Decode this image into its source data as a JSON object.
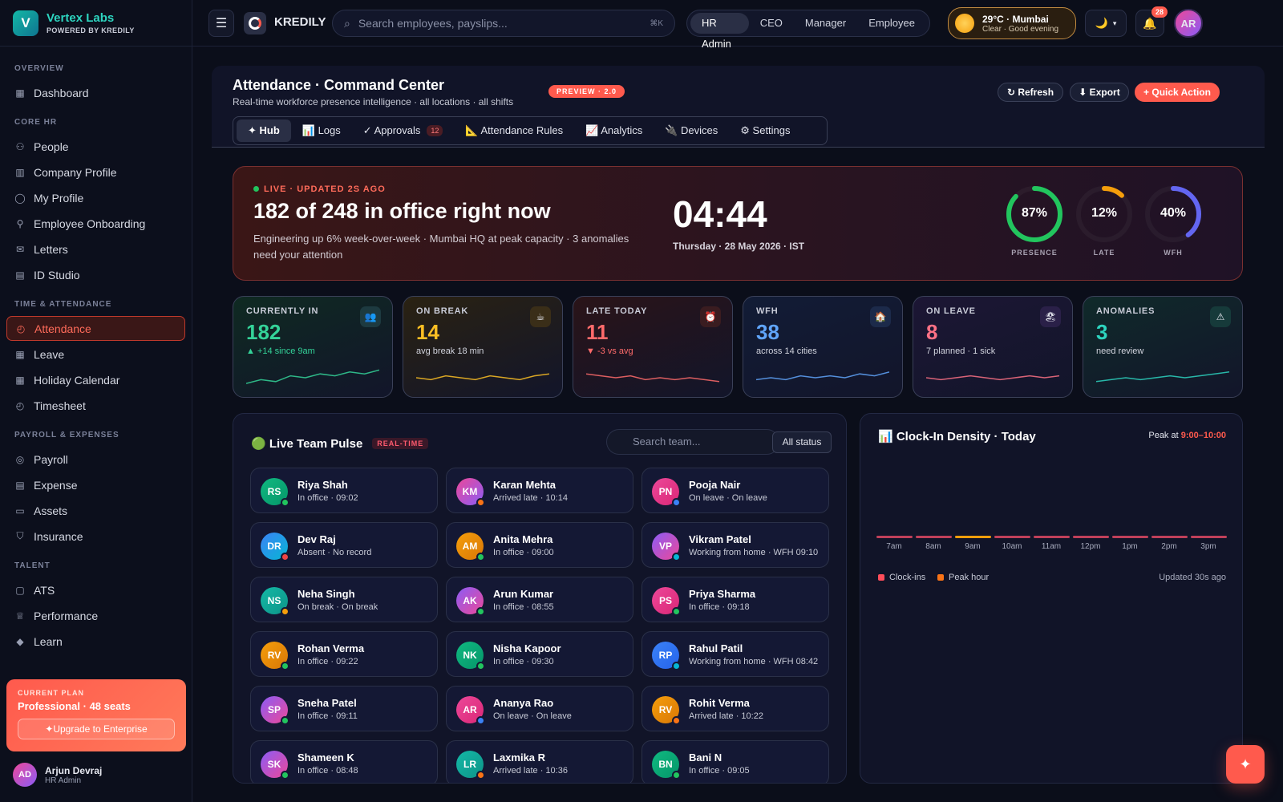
{
  "brand": {
    "name": "Vertex Labs",
    "sub": "POWERED BY KREDILY",
    "logo": "V"
  },
  "nav": {
    "sections": [
      {
        "title": "OVERVIEW",
        "items": [
          {
            "label": "Dashboard",
            "icon": "grid-icon"
          }
        ]
      },
      {
        "title": "CORE HR",
        "items": [
          {
            "label": "People",
            "icon": "people-icon"
          },
          {
            "label": "Company Profile",
            "icon": "building-icon"
          },
          {
            "label": "My Profile",
            "icon": "user-icon"
          },
          {
            "label": "Employee Onboarding",
            "icon": "user-plus-icon"
          },
          {
            "label": "Letters",
            "icon": "mail-icon"
          },
          {
            "label": "ID Studio",
            "icon": "id-card-icon"
          }
        ]
      },
      {
        "title": "TIME & ATTENDANCE",
        "items": [
          {
            "label": "Attendance",
            "icon": "clock-icon",
            "active": true
          },
          {
            "label": "Leave",
            "icon": "calendar-icon"
          },
          {
            "label": "Holiday Calendar",
            "icon": "calendar-icon"
          },
          {
            "label": "Timesheet",
            "icon": "clock-icon"
          }
        ]
      },
      {
        "title": "PAYROLL & EXPENSES",
        "items": [
          {
            "label": "Payroll",
            "icon": "coin-icon"
          },
          {
            "label": "Expense",
            "icon": "receipt-icon"
          },
          {
            "label": "Assets",
            "icon": "monitor-icon"
          },
          {
            "label": "Insurance",
            "icon": "shield-icon"
          }
        ]
      },
      {
        "title": "TALENT",
        "items": [
          {
            "label": "ATS",
            "icon": "clipboard-icon"
          },
          {
            "label": "Performance",
            "icon": "trophy-icon"
          },
          {
            "label": "Learn",
            "icon": "graduation-icon"
          }
        ]
      }
    ]
  },
  "plan": {
    "label": "CURRENT PLAN",
    "name": "Professional · 48 seats",
    "cta": "✦Upgrade to Enterprise"
  },
  "user": {
    "initials": "AD",
    "name": "Arjun Devraj",
    "role": "HR Admin"
  },
  "topbar": {
    "app_name": "KREDILY",
    "search_placeholder": "Search employees, payslips...",
    "search_kbd": "⌘K",
    "roles": [
      "HR Admin",
      "CEO",
      "Manager",
      "Employee"
    ],
    "weather_line1": "29°C · Mumbai",
    "weather_line2": "Clear · Good evening",
    "notif_count": "28",
    "avatar": "AR",
    "theme_icon": "🌙"
  },
  "header": {
    "title": "Attendance · Command Center",
    "subtitle": "Real-time workforce presence intelligence · all locations · all shifts",
    "badge": "PREVIEW · 2.0",
    "refresh": "↻ Refresh",
    "export": "⬇ Export",
    "quick": "+ Quick Action",
    "tabs": [
      {
        "label": "✦ Hub",
        "active": true
      },
      {
        "label": "📊 Logs"
      },
      {
        "label": "✓ Approvals",
        "count": "12"
      },
      {
        "label": "📐 Attendance Rules"
      },
      {
        "label": "📈 Analytics"
      },
      {
        "label": "🔌 Devices"
      },
      {
        "label": "⚙ Settings"
      }
    ]
  },
  "hero": {
    "live": "LIVE · UPDATED  2S  AGO",
    "title": "182 of 248 in office right now",
    "desc": "Engineering up 6% week-over-week · Mumbai HQ at peak capacity · 3 anomalies need your attention",
    "clock": "04:44",
    "date": "Thursday · 28 May 2026 · IST",
    "rings": [
      {
        "value": "87%",
        "label": "PRESENCE",
        "pct": 87,
        "color": "#22c55e"
      },
      {
        "value": "12%",
        "label": "LATE",
        "pct": 12,
        "color": "#f59e0b"
      },
      {
        "value": "40%",
        "label": "WFH",
        "pct": 40,
        "color": "#6366f1"
      }
    ]
  },
  "stats": [
    {
      "label": "CURRENTLY IN",
      "value": "182",
      "note": "▲ +14 since 9am",
      "color": "#34d399",
      "note_color": "#34d399",
      "bg": "#0f2a22",
      "icon": "👥",
      "icon_bg": "#1d3a40",
      "icon_name": "people-icon"
    },
    {
      "label": "ON BREAK",
      "value": "14",
      "note": "avg break 18 min",
      "color": "#fbbf24",
      "note_color": "#d2d4de",
      "bg": "#2a2212",
      "icon": "☕",
      "icon_bg": "#3a2e18",
      "icon_name": "coffee-icon"
    },
    {
      "label": "LATE TODAY",
      "value": "11",
      "note": "▼ -3 vs avg",
      "color": "#ff6b6b",
      "note_color": "#ff6b6b",
      "bg": "#2a1418",
      "icon": "⏰",
      "icon_bg": "#3a1c20",
      "icon_name": "alarm-icon"
    },
    {
      "label": "WFH",
      "value": "38",
      "note": "across 14 cities",
      "color": "#60a5fa",
      "note_color": "#d2d4de",
      "bg": "#121c36",
      "icon": "🏠",
      "icon_bg": "#1c2a4a",
      "icon_name": "home-icon"
    },
    {
      "label": "ON LEAVE",
      "value": "8",
      "note": "7 planned · 1 sick",
      "color": "#fb7185",
      "note_color": "#d2d4de",
      "bg": "#1c1634",
      "icon": "🏖",
      "icon_bg": "#2a2048",
      "icon_name": "beach-icon"
    },
    {
      "label": "ANOMALIES",
      "value": "3",
      "note": "need review",
      "color": "#2dd4bf",
      "note_color": "#d2d4de",
      "bg": "#102a2a",
      "icon": "⚠",
      "icon_bg": "#163a3a",
      "icon_name": "warning-icon"
    }
  ],
  "pulse": {
    "title": "🟢 Live Team Pulse",
    "badge": "REAL-TIME",
    "search_placeholder": "Search team...",
    "filter": "All status",
    "employees": [
      {
        "initials": "RS",
        "name": "Riya Shah",
        "status": "In office · 09:02",
        "grad": "#10b981,#059669",
        "dot": "#22c55e"
      },
      {
        "initials": "KM",
        "name": "Karan Mehta",
        "status": "Arrived late · 10:14",
        "grad": "#ec4899,#8b5cf6",
        "dot": "#f97316"
      },
      {
        "initials": "PN",
        "name": "Pooja Nair",
        "status": "On leave · On leave",
        "grad": "#ec4899,#db2777",
        "dot": "#3b82f6"
      },
      {
        "initials": "DR",
        "name": "Dev Raj",
        "status": "Absent · No record",
        "grad": "#3b82f6,#06b6d4",
        "dot": "#ef4444"
      },
      {
        "initials": "AM",
        "name": "Anita Mehra",
        "status": "In office · 09:00",
        "grad": "#f59e0b,#d97706",
        "dot": "#22c55e"
      },
      {
        "initials": "VP",
        "name": "Vikram Patel",
        "status": "Working from home · WFH 09:10",
        "grad": "#8b5cf6,#ec4899",
        "dot": "#06b6d4"
      },
      {
        "initials": "NS",
        "name": "Neha Singh",
        "status": "On break · On break",
        "grad": "#14b8a6,#0d9488",
        "dot": "#f59e0b"
      },
      {
        "initials": "AK",
        "name": "Arun Kumar",
        "status": "In office · 08:55",
        "grad": "#8b5cf6,#ec4899",
        "dot": "#22c55e"
      },
      {
        "initials": "PS",
        "name": "Priya Sharma",
        "status": "In office · 09:18",
        "grad": "#ec4899,#db2777",
        "dot": "#22c55e"
      },
      {
        "initials": "RV",
        "name": "Rohan Verma",
        "status": "In office · 09:22",
        "grad": "#f59e0b,#d97706",
        "dot": "#22c55e"
      },
      {
        "initials": "NK",
        "name": "Nisha Kapoor",
        "status": "In office · 09:30",
        "grad": "#10b981,#059669",
        "dot": "#22c55e"
      },
      {
        "initials": "RP",
        "name": "Rahul Patil",
        "status": "Working from home · WFH 08:42",
        "grad": "#3b82f6,#2563eb",
        "dot": "#06b6d4"
      },
      {
        "initials": "SP",
        "name": "Sneha Patel",
        "status": "In office · 09:11",
        "grad": "#8b5cf6,#ec4899",
        "dot": "#22c55e"
      },
      {
        "initials": "AR",
        "name": "Ananya Rao",
        "status": "On leave · On leave",
        "grad": "#ec4899,#db2777",
        "dot": "#3b82f6"
      },
      {
        "initials": "RV",
        "name": "Rohit Verma",
        "status": "Arrived late · 10:22",
        "grad": "#f59e0b,#d97706",
        "dot": "#f97316"
      },
      {
        "initials": "SK",
        "name": "Shameen K",
        "status": "In office · 08:48",
        "grad": "#8b5cf6,#ec4899",
        "dot": "#22c55e"
      },
      {
        "initials": "LR",
        "name": "Laxmika R",
        "status": "Arrived late · 10:36",
        "grad": "#14b8a6,#0d9488",
        "dot": "#f97316"
      },
      {
        "initials": "BN",
        "name": "Bani N",
        "status": "In office · 09:05",
        "grad": "#10b981,#059669",
        "dot": "#22c55e"
      }
    ]
  },
  "density": {
    "title": "📊 Clock-In Density · Today",
    "peak_prefix": "Peak at ",
    "peak": "9:00–10:00",
    "hours": [
      "7am",
      "8am",
      "9am",
      "10am",
      "11am",
      "12pm",
      "1pm",
      "2pm",
      "3pm"
    ],
    "peak_index": 2,
    "legend_clock": "Clock-ins",
    "legend_peak": "Peak hour",
    "updated": "Updated 30s ago",
    "bar_color": "#c0405a",
    "peak_color": "#f59e0b"
  },
  "fab_icon": "✦"
}
